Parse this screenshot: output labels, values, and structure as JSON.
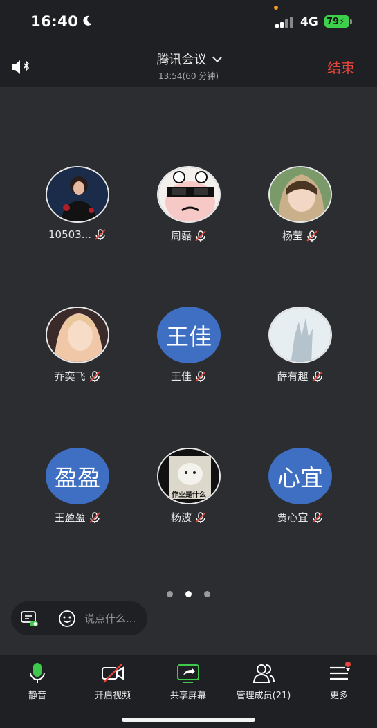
{
  "status_bar": {
    "time": "16:40",
    "network": "4G",
    "battery": "79"
  },
  "header": {
    "title": "腾讯会议",
    "subtitle": "13:54(60 分钟)",
    "end_label": "结束"
  },
  "participants": [
    {
      "name": "10503...",
      "avatar_text": ""
    },
    {
      "name": "周磊",
      "avatar_text": ""
    },
    {
      "name": "杨莹",
      "avatar_text": ""
    },
    {
      "name": "乔奕飞",
      "avatar_text": ""
    },
    {
      "name": "王佳",
      "avatar_text": "王佳"
    },
    {
      "name": "薛有趣",
      "avatar_text": ""
    },
    {
      "name": "王盈盈",
      "avatar_text": "盈盈"
    },
    {
      "name": "杨波",
      "avatar_text": "作业是什么"
    },
    {
      "name": "贾心宜",
      "avatar_text": "心宜"
    }
  ],
  "pagination": {
    "total": 3,
    "active": 1
  },
  "chat": {
    "placeholder": "说点什么..."
  },
  "toolbar": {
    "mute_label": "静音",
    "video_label": "开启视频",
    "share_label": "共享屏幕",
    "members_label": "管理成员(21)",
    "more_label": "更多"
  },
  "colors": {
    "end": "#e8453c",
    "avatar_blue": "#3e6fc3",
    "mic_green": "#3fc94c",
    "battery": "#3dd14b",
    "notify": "#e8453c"
  }
}
